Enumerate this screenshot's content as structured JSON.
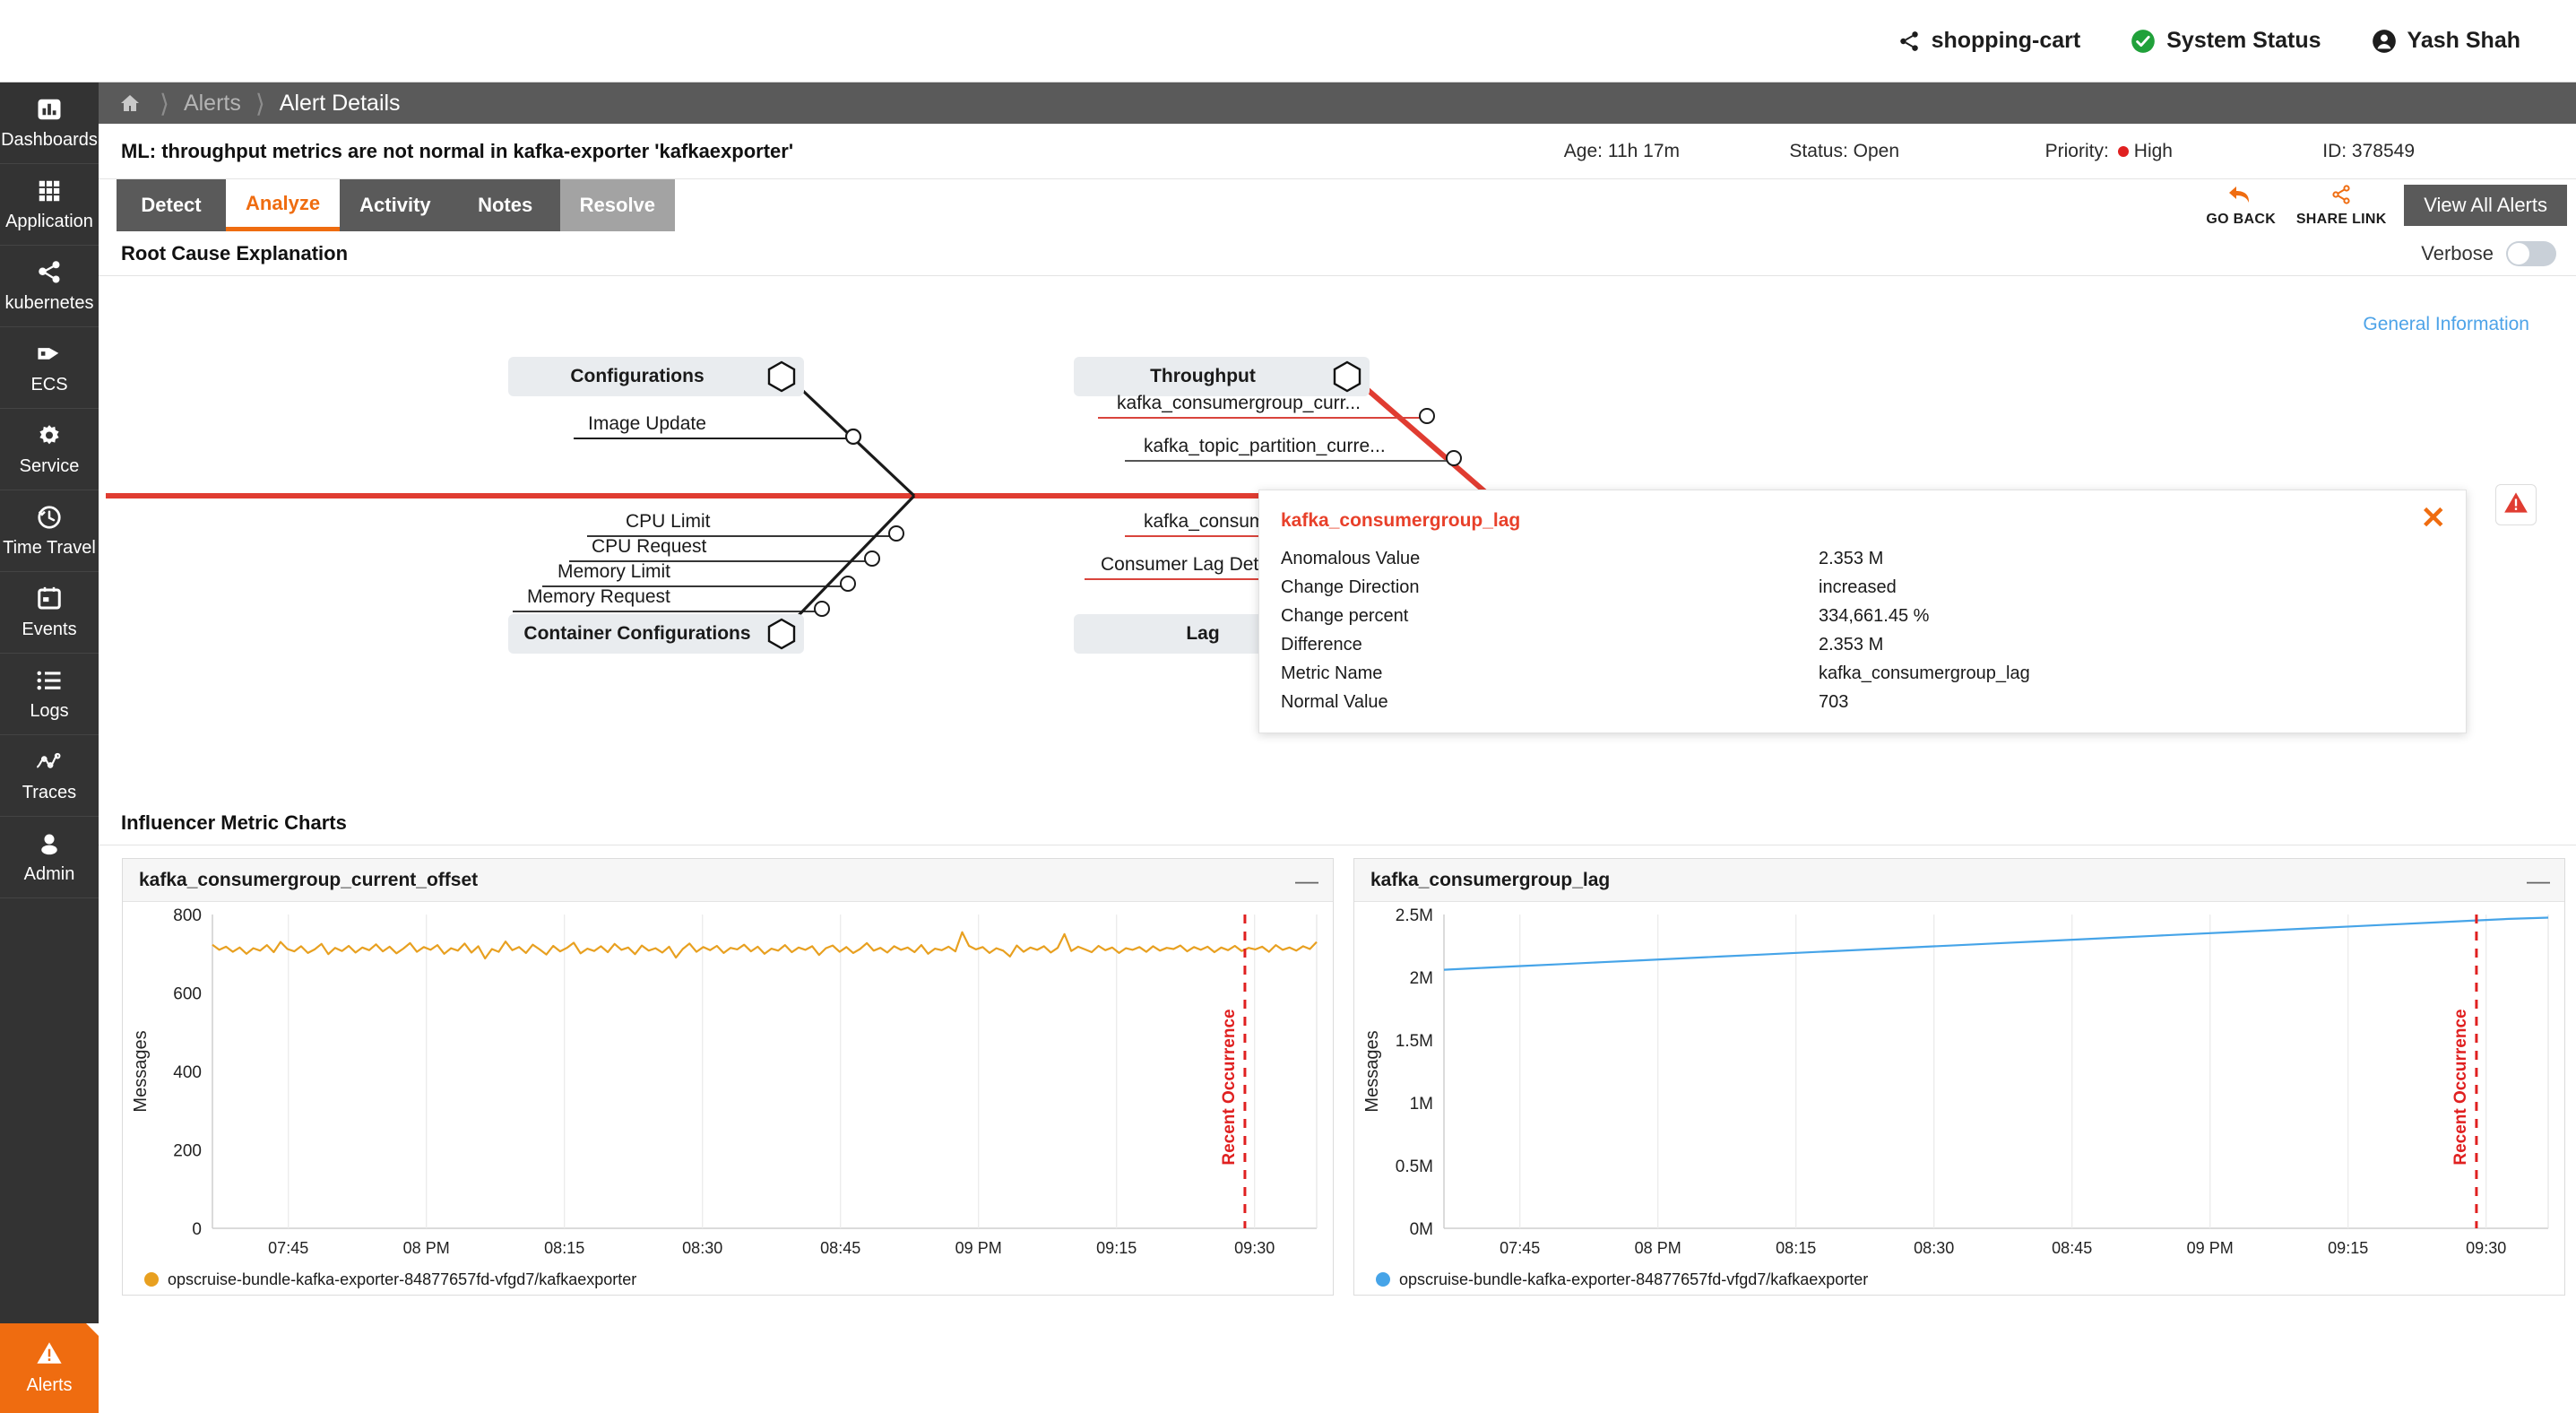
{
  "topbar": {
    "items": [
      {
        "icon": "share-nodes-icon",
        "label": "shopping-cart"
      },
      {
        "icon": "check-circle-icon",
        "label": "System Status"
      },
      {
        "icon": "user-circle-icon",
        "label": "Yash Shah"
      }
    ]
  },
  "sidebar": {
    "items": [
      {
        "icon": "bar-chart-icon",
        "label": "Dashboards"
      },
      {
        "icon": "grid-apps-icon",
        "label": "Application"
      },
      {
        "icon": "share-nodes-icon",
        "label": "kubernetes"
      },
      {
        "icon": "container-icon",
        "label": "ECS"
      },
      {
        "icon": "gear-icon",
        "label": "Service"
      },
      {
        "icon": "clock-history-icon",
        "label": "Time Travel"
      },
      {
        "icon": "calendar-icon",
        "label": "Events"
      },
      {
        "icon": "list-icon",
        "label": "Logs"
      },
      {
        "icon": "traces-icon",
        "label": "Traces"
      },
      {
        "icon": "user-icon",
        "label": "Admin"
      }
    ],
    "bottom": {
      "icon": "warning-triangle-icon",
      "label": "Alerts"
    }
  },
  "breadcrumb": {
    "home_icon": "home-icon",
    "items": [
      "Alerts",
      "Alert Details"
    ]
  },
  "alert": {
    "title": "ML: throughput metrics are not normal in kafka-exporter 'kafkaexporter'",
    "age": "Age: 11h 17m",
    "status": "Status: Open",
    "priority_label": "Priority:",
    "priority_value": "High",
    "priority_color": "#e02020",
    "id": "ID: 378549"
  },
  "tabs": [
    {
      "label": "Detect",
      "state": "normal"
    },
    {
      "label": "Analyze",
      "state": "active"
    },
    {
      "label": "Activity",
      "state": "normal"
    },
    {
      "label": "Notes",
      "state": "normal"
    },
    {
      "label": "Resolve",
      "state": "muted"
    }
  ],
  "toolbar": {
    "go_back": "GO BACK",
    "share_link": "SHARE LINK",
    "view_all": "View All Alerts"
  },
  "root_cause": {
    "title": "Root Cause Explanation",
    "verbose_label": "Verbose",
    "verbose_on": false,
    "general_information": "General Information"
  },
  "fishbone": {
    "categories": [
      {
        "name": "Configurations",
        "position": "top-left"
      },
      {
        "name": "Throughput",
        "position": "top-right"
      },
      {
        "name": "Container Configurations",
        "position": "bottom-left"
      },
      {
        "name": "Lag",
        "position": "bottom-right"
      }
    ],
    "bones": [
      {
        "label": "Image Update",
        "group": "Configurations",
        "color": "#222222"
      },
      {
        "label": "CPU Limit",
        "group": "Container Configurations",
        "color": "#222222"
      },
      {
        "label": "CPU Request",
        "group": "Container Configurations",
        "color": "#222222"
      },
      {
        "label": "Memory Limit",
        "group": "Container Configurations",
        "color": "#222222"
      },
      {
        "label": "Memory Request",
        "group": "Container Configurations",
        "color": "#222222"
      },
      {
        "label": "kafka_consumergroup_curr...",
        "group": "Throughput",
        "color": "#d9443c"
      },
      {
        "label": "kafka_topic_partition_curre...",
        "group": "Throughput",
        "color": "#555555"
      },
      {
        "label": "kafka_consumergroup_",
        "group": "Lag",
        "color": "#d9443c"
      },
      {
        "label": "Consumer Lag Details (Me...",
        "group": "Lag",
        "color": "#d9443c"
      }
    ],
    "spine_color": "#e03c31"
  },
  "popup": {
    "title": "kafka_consumergroup_lag",
    "close_icon": "close-icon",
    "rows": [
      {
        "key": "Anomalous Value",
        "value": "2.353 M"
      },
      {
        "key": "Change Direction",
        "value": "increased"
      },
      {
        "key": "Change percent",
        "value": "334,661.45 %"
      },
      {
        "key": "Difference",
        "value": "2.353 M"
      },
      {
        "key": "Metric Name",
        "value": "kafka_consumergroup_lag"
      },
      {
        "key": "Normal Value",
        "value": "703"
      }
    ]
  },
  "influencer": {
    "title": "Influencer Metric Charts"
  },
  "chart_data": [
    {
      "type": "line",
      "title": "kafka_consumergroup_current_offset",
      "xlabel": "",
      "ylabel": "Messages",
      "ylim": [
        0,
        800
      ],
      "yticks": [
        0,
        200,
        400,
        600,
        800
      ],
      "ytick_labels": [
        "0",
        "200",
        "400",
        "600",
        "800"
      ],
      "xtick_labels": [
        "07:45",
        "08 PM",
        "08:15",
        "08:30",
        "08:45",
        "09 PM",
        "09:15",
        "09:30"
      ],
      "grid": true,
      "series": [
        {
          "name": "opscruise-bundle-kafka-exporter-84877657fd-vfgd7/kafkaexporter",
          "color": "#e8a020",
          "approx_mean": 715,
          "approx_min": 685,
          "approx_max": 760,
          "values": [
            723,
            710,
            718,
            705,
            716,
            700,
            714,
            708,
            722,
            704,
            730,
            712,
            706,
            719,
            702,
            711,
            725,
            699,
            715,
            707,
            720,
            703,
            716,
            709,
            724,
            706,
            718,
            701,
            713,
            727,
            705,
            717,
            710,
            722,
            700,
            714,
            708,
            726,
            703,
            719,
            688,
            712,
            705,
            731,
            709,
            717,
            702,
            723,
            711,
            698,
            720,
            706,
            715,
            728,
            701,
            713,
            707,
            719,
            704,
            725,
            710,
            716,
            699,
            721,
            708,
            714,
            703,
            718,
            690,
            712,
            726,
            705,
            717,
            709,
            720,
            702,
            715,
            711,
            723,
            706,
            718,
            700,
            713,
            708,
            722,
            704,
            716,
            710,
            719,
            697,
            714,
            721,
            705,
            717,
            702,
            712,
            727,
            708,
            715,
            703,
            719,
            710,
            716,
            704,
            722,
            700,
            713,
            709,
            718,
            706,
            755,
            720,
            711,
            717,
            702,
            714,
            708,
            693,
            721,
            705,
            716,
            710,
            719,
            703,
            715,
            750,
            707,
            718,
            711,
            704,
            720,
            709,
            716,
            702,
            714,
            710,
            717,
            705,
            719,
            708,
            715,
            712,
            721,
            706,
            717,
            710,
            718,
            704,
            716,
            709,
            720,
            707,
            715,
            711,
            718,
            705,
            722,
            710,
            716,
            708,
            719,
            712,
            730
          ]
        }
      ],
      "annotation": {
        "text": "Recent Occurrence",
        "color": "#e02020",
        "style": "dashed-vertical",
        "x_fraction": 0.935
      }
    },
    {
      "type": "line",
      "title": "kafka_consumergroup_lag",
      "xlabel": "",
      "ylabel": "Messages",
      "ylim": [
        0,
        2500000
      ],
      "yticks": [
        0,
        500000,
        1000000,
        1500000,
        2000000,
        2500000
      ],
      "ytick_labels": [
        "0M",
        "0.5M",
        "1M",
        "1.5M",
        "2M",
        "2.5M"
      ],
      "xtick_labels": [
        "07:45",
        "08 PM",
        "08:15",
        "08:30",
        "08:45",
        "09 PM",
        "09:15",
        "09:30"
      ],
      "grid": true,
      "series": [
        {
          "name": "opscruise-bundle-kafka-exporter-84877657fd-vfgd7/kafkaexporter",
          "color": "#46a4e8",
          "start_value": 2060000,
          "end_value": 2475000,
          "values": [
            2060000,
            2075000,
            2090000,
            2105000,
            2120000,
            2135000,
            2150000,
            2165000,
            2180000,
            2195000,
            2210000,
            2225000,
            2240000,
            2255000,
            2270000,
            2285000,
            2300000,
            2315000,
            2330000,
            2345000,
            2360000,
            2375000,
            2390000,
            2405000,
            2420000,
            2435000,
            2450000,
            2465000,
            2475000
          ]
        }
      ],
      "annotation": {
        "text": "Recent Occurrence",
        "color": "#e02020",
        "style": "dashed-vertical",
        "x_fraction": 0.935
      }
    }
  ]
}
